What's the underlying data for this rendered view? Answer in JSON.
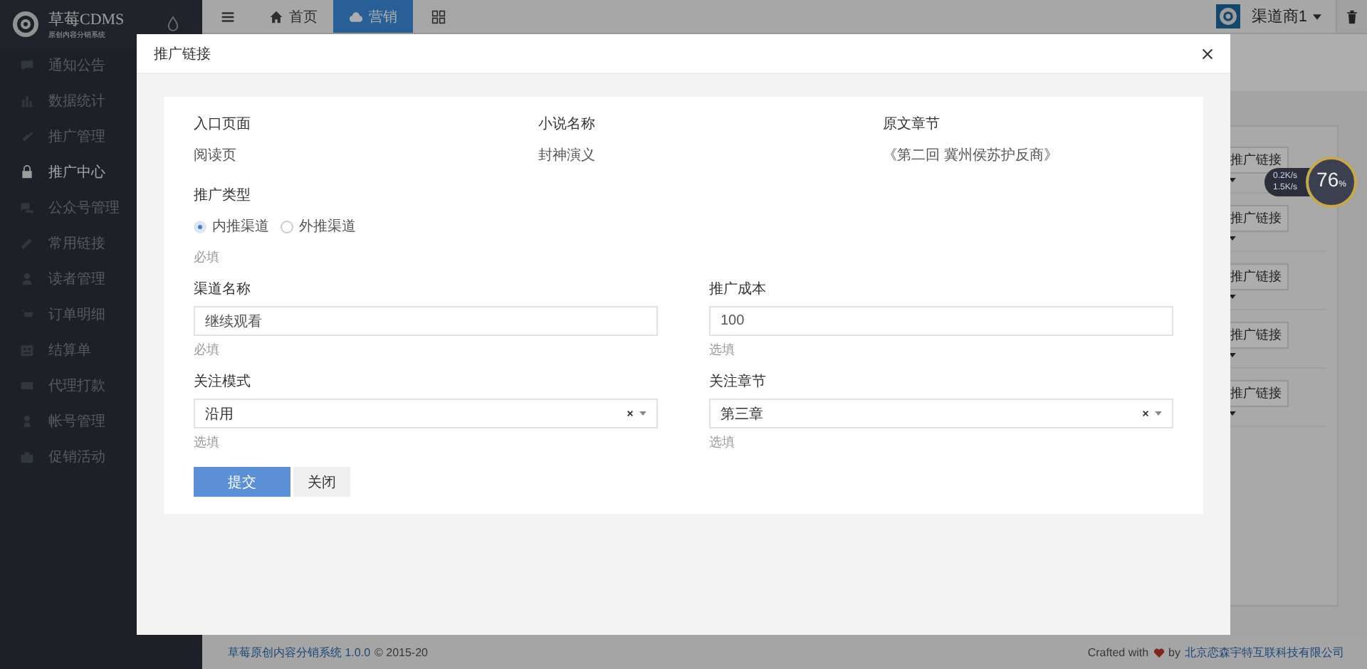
{
  "sidebar": {
    "brand": "草莓CDMS",
    "brand_subtitle": "原创内容分销系统",
    "items": [
      {
        "label": "通知公告",
        "selected": false
      },
      {
        "label": "数据统计",
        "selected": false
      },
      {
        "label": "推广管理",
        "selected": false
      },
      {
        "label": "推广中心",
        "selected": true
      },
      {
        "label": "公众号管理",
        "selected": false
      },
      {
        "label": "常用链接",
        "selected": false
      },
      {
        "label": "读者管理",
        "selected": false
      },
      {
        "label": "订单明细",
        "selected": false
      },
      {
        "label": "结算单",
        "selected": false
      },
      {
        "label": "代理打款",
        "selected": false
      },
      {
        "label": "帐号管理",
        "selected": false
      },
      {
        "label": "促销活动",
        "selected": false
      }
    ]
  },
  "topbar": {
    "tabs": [
      {
        "label": "首页",
        "selected": false
      },
      {
        "label": "营销",
        "selected": true
      }
    ],
    "user": "渠道商1"
  },
  "background": {
    "row_buttons": [
      "推广链接",
      "推广链接",
      "推广链接",
      "推广链接",
      "推广链接"
    ]
  },
  "footer": {
    "product": "草莓原创内容分销系统 1.0.0",
    "copyright": "© 2015-20",
    "crafted": "Crafted with",
    "by": "by",
    "company": "北京恋森宇特互联科技有限公司"
  },
  "net_meter": {
    "upload": "0.2K/s",
    "download": "1.5K/s",
    "percent": "76",
    "unit": "%"
  },
  "dialog": {
    "title": "推广链接",
    "info": [
      {
        "label": "入口页面",
        "value": "阅读页"
      },
      {
        "label": "小说名称",
        "value": "封神演义"
      },
      {
        "label": "原文章节",
        "value": "《第二回 冀州侯苏护反商》"
      }
    ],
    "promo_type": {
      "label": "推广类型",
      "hint": "必填",
      "options": [
        {
          "label": "内推渠道",
          "selected": true
        },
        {
          "label": "外推渠道",
          "selected": false
        }
      ]
    },
    "fields": [
      {
        "kind": "input",
        "label": "渠道名称",
        "value": "继续观看",
        "hint": "必填"
      },
      {
        "kind": "input",
        "label": "推广成本",
        "value": "100",
        "hint": "选填"
      },
      {
        "kind": "select",
        "label": "关注模式",
        "value": "沿用",
        "hint": "选填"
      },
      {
        "kind": "select",
        "label": "关注章节",
        "value": "第三章",
        "hint": "选填"
      }
    ],
    "buttons": [
      {
        "label": "提交",
        "kind": "primary"
      },
      {
        "label": "关闭",
        "kind": "default"
      }
    ]
  }
}
